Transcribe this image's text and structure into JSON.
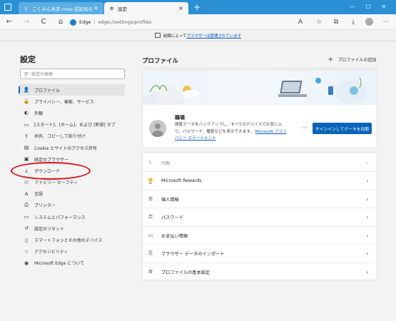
{
  "browser": {
    "tabs": [
      {
        "label": "ごくみん共済 coop 認証局のダイン"
      },
      {
        "label": "設定"
      }
    ],
    "nav": {
      "back": "←",
      "forward": "→",
      "refresh": "C",
      "home": "⌂"
    },
    "address": {
      "site": "Edge",
      "separator": "|",
      "url": "edge://settings/profiles"
    },
    "window": {
      "minimize": "—",
      "maximize": "☐",
      "close": "✕"
    }
  },
  "banner": {
    "prefix": "組織によって",
    "link": "ブラウザーは管理されています"
  },
  "sidebar": {
    "title": "設定",
    "search_placeholder": "設定の検索",
    "items": [
      {
        "label": "プロファイル",
        "icon": "person-icon",
        "glyph": "👤"
      },
      {
        "label": "プライバシー、検索、サービス",
        "icon": "lock-icon",
        "glyph": "🔒"
      },
      {
        "label": "外観",
        "icon": "palette-icon",
        "glyph": "◐"
      },
      {
        "label": "[スタート]、[ホーム]、および [新規] タブ",
        "icon": "home-icon",
        "glyph": "▭"
      },
      {
        "label": "共有、コピーして貼り付け",
        "icon": "share-icon",
        "glyph": "⇪"
      },
      {
        "label": "Cookie とサイトのアクセス許可",
        "icon": "site-permissions-icon",
        "glyph": "▤"
      },
      {
        "label": "既定のブラウザー",
        "icon": "browser-icon",
        "glyph": "▣"
      },
      {
        "label": "ダウンロード",
        "icon": "download-icon",
        "glyph": "⤓"
      },
      {
        "label": "ファミリー セーフティ",
        "icon": "family-icon",
        "glyph": "⚇"
      },
      {
        "label": "言語",
        "icon": "language-icon",
        "glyph": "A"
      },
      {
        "label": "プリンター",
        "icon": "printer-icon",
        "glyph": "⎙"
      },
      {
        "label": "システムとパフォーマンス",
        "icon": "system-icon",
        "glyph": "▭"
      },
      {
        "label": "設定のリセット",
        "icon": "reset-icon",
        "glyph": "↺"
      },
      {
        "label": "スマートフォンとその他のデバイス",
        "icon": "phone-icon",
        "glyph": "▯"
      },
      {
        "label": "アクセシビリティ",
        "icon": "accessibility-icon",
        "glyph": "☆"
      },
      {
        "label": "Microsoft Edge について",
        "icon": "edge-icon",
        "glyph": "◉"
      }
    ]
  },
  "main": {
    "title": "プロファイル",
    "add_profile": "プロファイルの追加",
    "profile": {
      "name": "職場",
      "description": "閲覧データをバックアップし、すべてのデバイスでお気に入り、パスワード、履歴などを表示できます。",
      "privacy_link": "Microsoft プライバシー ステートメント",
      "more": "···",
      "signin_button": "サインインしてデータを同期"
    },
    "rows": [
      {
        "label": "同期",
        "icon": "sync-icon",
        "glyph": "↻",
        "disabled": true
      },
      {
        "label": "Microsoft Rewards",
        "icon": "rewards-icon",
        "glyph": "🏆",
        "disabled": false
      },
      {
        "label": "個人情報",
        "icon": "personal-info-icon",
        "glyph": "☰",
        "disabled": false
      },
      {
        "label": "パスワード",
        "icon": "key-icon",
        "glyph": "⚿",
        "disabled": false
      },
      {
        "label": "お支払い情報",
        "icon": "card-icon",
        "glyph": "▭",
        "disabled": false
      },
      {
        "label": "ブラウザー データのインポート",
        "icon": "import-icon",
        "glyph": "⎘",
        "disabled": false
      },
      {
        "label": "プロファイルの基本設定",
        "icon": "profile-settings-icon",
        "glyph": "⚙",
        "disabled": false
      }
    ]
  },
  "colors": {
    "accent": "#0a63b8",
    "titlebar": "#2b8fd4",
    "annotation": "#d9101b"
  }
}
